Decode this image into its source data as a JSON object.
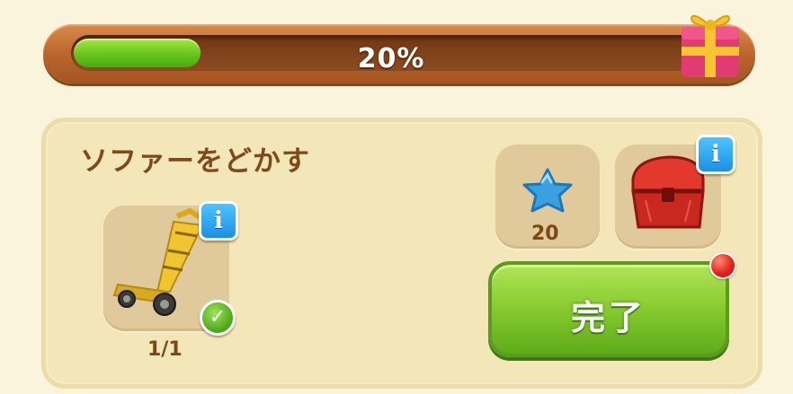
{
  "progress": {
    "percent": 0.2,
    "label": "20%",
    "reward_icon": "gift-box-icon"
  },
  "task": {
    "title": "ソファーをどかす",
    "tool": {
      "icon": "hand-truck-icon",
      "count": "1/1",
      "completed": true
    },
    "rewards": [
      {
        "icon": "blue-star-icon",
        "count": "20"
      },
      {
        "icon": "red-chest-icon"
      }
    ],
    "complete_button_label": "完了",
    "colors": {
      "accent_green": "#86ca2e",
      "progress_brown": "#b9632c",
      "panel_bg": "#f3e6b9",
      "notification_red": "#e4241a",
      "info_blue": "#1d8fe4"
    }
  }
}
